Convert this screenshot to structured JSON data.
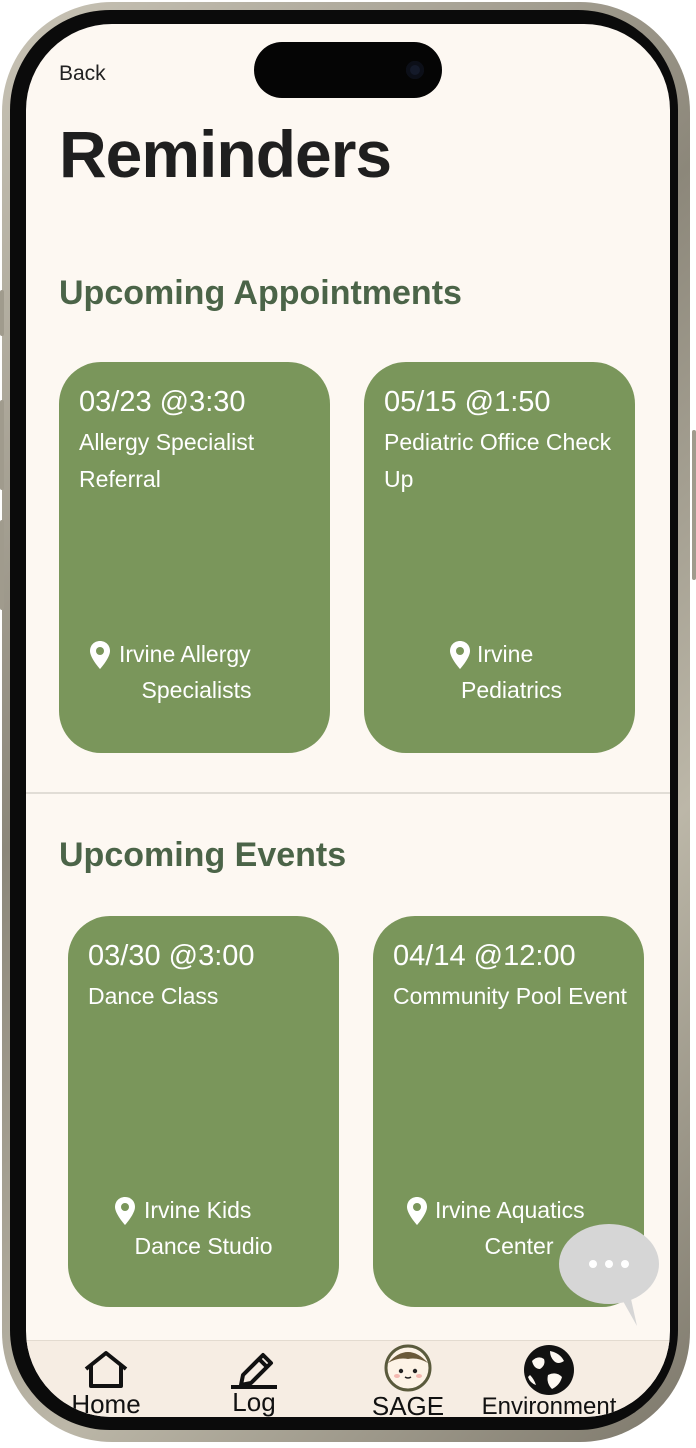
{
  "header": {
    "back_label": "Back",
    "title": "Reminders"
  },
  "appointments": {
    "section_title": "Upcoming Appointments",
    "cards": [
      {
        "date": "03/23 @3:30",
        "title": "Allergy Specialist Referral",
        "location": "Irvine Allergy Specialists"
      },
      {
        "date": "05/15 @1:50",
        "title": "Pediatric Office Check Up",
        "location": "Irvine Pediatrics"
      }
    ]
  },
  "events": {
    "section_title": "Upcoming Events",
    "cards": [
      {
        "date": "03/30 @3:00",
        "title": "Dance Class",
        "location": "Irvine Kids Dance Studio"
      },
      {
        "date": "04/14 @12:00",
        "title": "Community Pool Event",
        "location": "Irvine Aquatics Center"
      }
    ]
  },
  "chat": {
    "icon": "chat-bubble-icon"
  },
  "tab_bar": {
    "items": [
      {
        "label": "Home",
        "icon": "home-icon"
      },
      {
        "label": "Log",
        "icon": "pencil-icon"
      },
      {
        "label": "SAGE",
        "icon": "sage-face-icon"
      },
      {
        "label": "Environment",
        "icon": "globe-icon"
      }
    ]
  },
  "colors": {
    "background": "#fdf8f2",
    "card": "#7a965b",
    "section_title": "#4b6448",
    "tab_bar": "#f6ede3"
  }
}
